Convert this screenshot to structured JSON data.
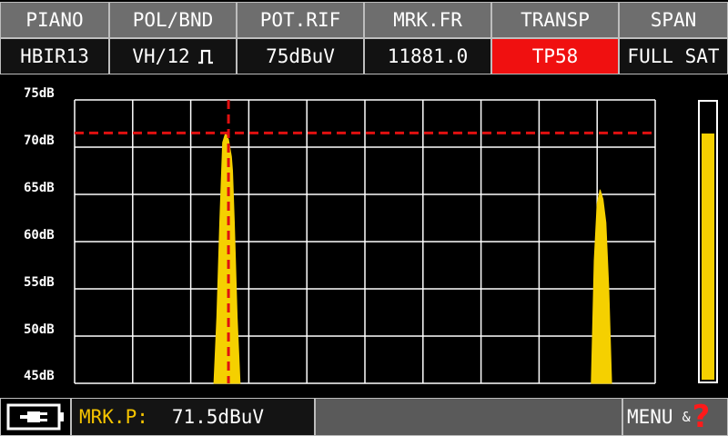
{
  "header": {
    "columns": [
      {
        "label": "PIANO",
        "value": "HBIR13"
      },
      {
        "label": "POL/BND",
        "value": "VH/12"
      },
      {
        "label": "POT.RIF",
        "value": "75dBuV"
      },
      {
        "label": "MRK.FR",
        "value": "11881.0"
      },
      {
        "label": "TRANSP",
        "value": "TP58"
      },
      {
        "label": "SPAN",
        "value": "FULL SAT"
      }
    ],
    "active_value_index": 4,
    "active_color": "#f01010",
    "pol_icon": "pulse-square-icon"
  },
  "chart_data": {
    "type": "area",
    "yticks": [
      "75dB",
      "70dB",
      "65dB",
      "60dB",
      "55dB",
      "50dB",
      "45dB"
    ],
    "ylim": [
      45,
      75
    ],
    "xlim": [
      0,
      10
    ],
    "grid": true,
    "marker_level_db": 71.5,
    "marker_x": 2.65,
    "series": [
      {
        "values": [
          [
            2.4,
            45
          ],
          [
            2.45,
            52
          ],
          [
            2.5,
            62
          ],
          [
            2.55,
            70.5
          ],
          [
            2.6,
            71.5
          ],
          [
            2.65,
            70.8
          ],
          [
            2.7,
            69
          ],
          [
            2.72,
            67.5
          ],
          [
            2.75,
            62
          ],
          [
            2.8,
            52
          ],
          [
            2.85,
            45
          ]
        ]
      },
      {
        "values": [
          [
            8.9,
            45
          ],
          [
            8.95,
            58
          ],
          [
            9.0,
            64
          ],
          [
            9.05,
            65.5
          ],
          [
            9.1,
            64.5
          ],
          [
            9.15,
            62
          ],
          [
            9.2,
            55
          ],
          [
            9.25,
            45
          ]
        ]
      }
    ],
    "series_color": "#f5d000",
    "marker_color": "#e01010"
  },
  "level_meter": {
    "fraction": 0.88,
    "color": "#f5d000"
  },
  "footer": {
    "battery_icon": "battery-plug-icon",
    "marker_label": "MRK.P:",
    "marker_value": "71.5dBuV",
    "menu_label": "MENU",
    "menu_amp": "&",
    "help_glyph": "?"
  }
}
